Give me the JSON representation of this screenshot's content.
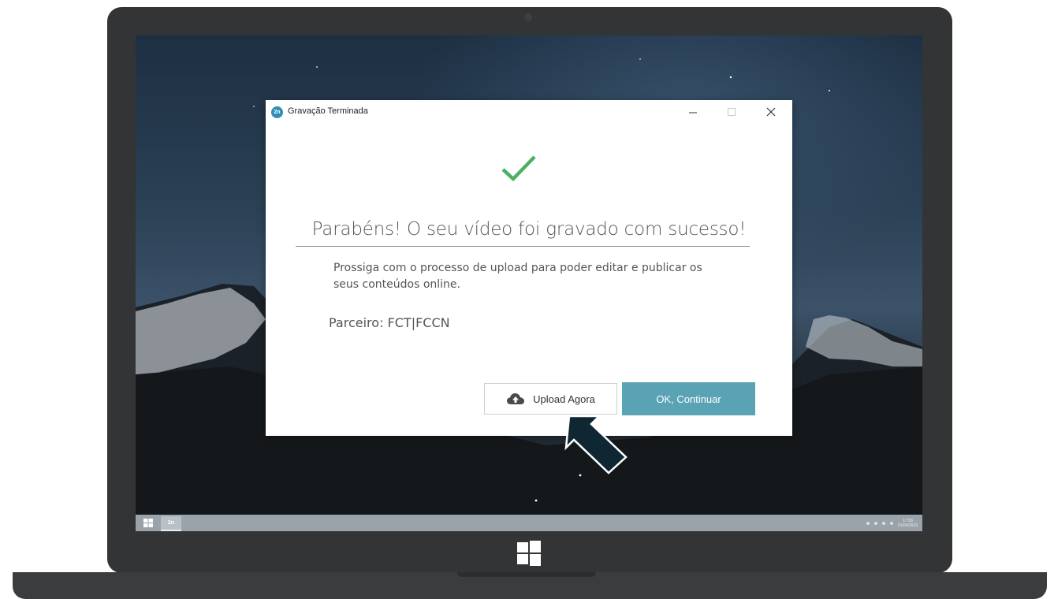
{
  "dialog": {
    "title": "Gravação Terminada",
    "app_icon_text": "2n",
    "headline": "Parabéns! O seu vídeo foi gravado com sucesso!",
    "body_line1": "Prossiga com o processo de upload para poder editar e publicar os",
    "body_line2": "seus conteúdos online.",
    "partner": "Parceiro: FCT|FCCN",
    "upload_button_label": "Upload Agora",
    "ok_button_label": "OK, Continuar",
    "success_icon": "check-icon",
    "upload_icon": "cloud-upload-icon"
  },
  "taskbar": {
    "app_icon_text": "2n",
    "clock_time": "17:58",
    "clock_date": "01/04/2019"
  },
  "colors": {
    "accent": "#5aa3b5",
    "check": "#4caf62",
    "laptop": "#323436",
    "cursor": "#0f2633"
  }
}
